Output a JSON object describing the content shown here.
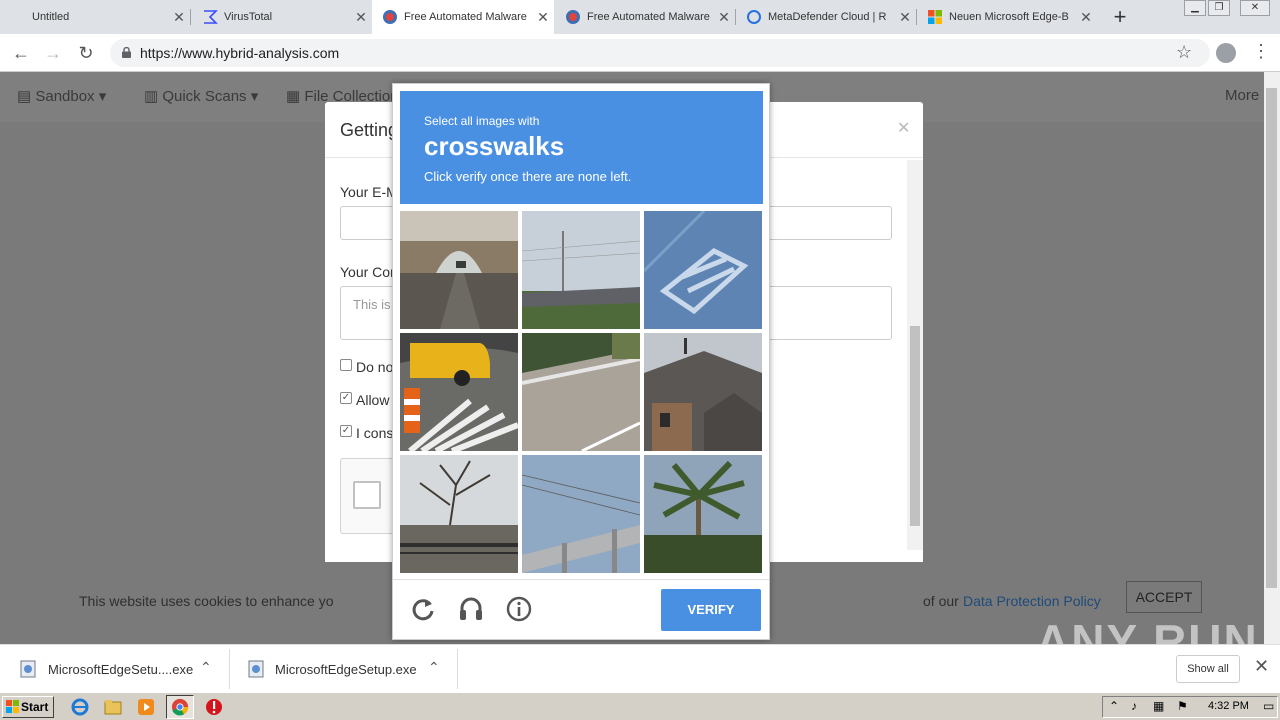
{
  "tabs": [
    {
      "title": "Untitled",
      "icon": "blank-page-icon",
      "active": false
    },
    {
      "title": "VirusTotal",
      "icon": "virustotal-icon",
      "active": false
    },
    {
      "title": "Free Automated Malware",
      "icon": "hybrid-analysis-icon",
      "active": true
    },
    {
      "title": "Free Automated Malware",
      "icon": "hybrid-analysis-icon",
      "active": false
    },
    {
      "title": "MetaDefender Cloud | R",
      "icon": "metadefender-icon",
      "active": false
    },
    {
      "title": "Neuen Microsoft Edge-B",
      "icon": "microsoft-icon",
      "active": false
    }
  ],
  "address_bar": {
    "url": "https://www.hybrid-analysis.com"
  },
  "site_nav": {
    "items": [
      "Sandbox",
      "Quick Scans",
      "File Collection",
      "More"
    ]
  },
  "modal": {
    "title": "Getting",
    "email_label": "Your E-M",
    "comment_label": "Your Cor",
    "comment_placeholder": "This is",
    "check1": "Do no",
    "check2": "Allow",
    "check3": "I cons"
  },
  "cookie": {
    "text": "This website uses cookies to enhance yo",
    "text_end": "of our",
    "link": "Data Protection Policy",
    "accept": "ACCEPT"
  },
  "captcha": {
    "select_text": "Select all images with",
    "target": "crosswalks",
    "instruction": "Click verify once there are none left.",
    "verify": "VERIFY"
  },
  "watermark": "ANY RUN",
  "downloads": {
    "items": [
      "MicrosoftEdgeSetu....exe",
      "MicrosoftEdgeSetup.exe"
    ],
    "show_all": "Show all"
  },
  "taskbar": {
    "start": "Start",
    "clock": "4:32 PM"
  },
  "colors": {
    "captcha_blue": "#4a90e2",
    "page_overlay": "#7a7a7a",
    "tab_strip": "#dee1e6"
  }
}
